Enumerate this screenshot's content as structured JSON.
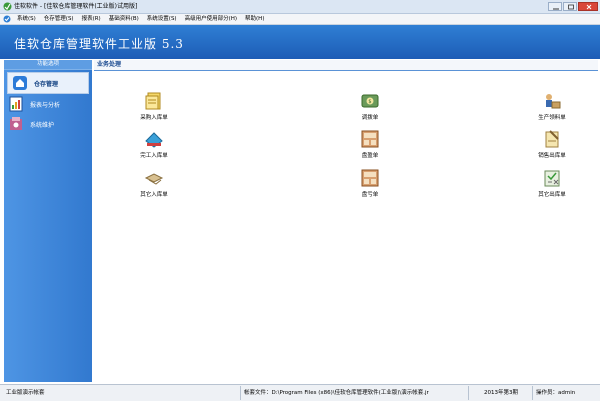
{
  "window": {
    "title": "佳软软件 - [佳软仓库管理软件(工业版)试用版]"
  },
  "menu": [
    "系统(S)",
    "仓存管理(S)",
    "报表(R)",
    "基础资料(B)",
    "系统设置(S)",
    "高级用户使用部分(H)",
    "帮助(H)"
  ],
  "banner": {
    "title": "佳软仓库管理软件工业版 5.3"
  },
  "sidebar": {
    "header": "功能选项",
    "items": [
      {
        "label": "仓存管理",
        "icon": "warehouse-icon"
      },
      {
        "label": "报表与分析",
        "icon": "report-icon"
      },
      {
        "label": "系统维护",
        "icon": "maintenance-icon"
      }
    ]
  },
  "main": {
    "header": "业务处理",
    "items": [
      {
        "label": "采购入库单",
        "icon": "purchase-receipt-icon"
      },
      {
        "label": "调拨单",
        "icon": "transfer-icon"
      },
      {
        "label": "生产领料单",
        "icon": "material-requisition-icon"
      },
      {
        "label": "完工入库单",
        "icon": "completion-receipt-icon"
      },
      {
        "label": "盘盈单",
        "icon": "inventory-gain-icon"
      },
      {
        "label": "销售出库单",
        "icon": "sales-delivery-icon"
      },
      {
        "label": "其它入库单",
        "icon": "other-receipt-icon"
      },
      {
        "label": "盘亏单",
        "icon": "inventory-loss-icon"
      },
      {
        "label": "其它出库单",
        "icon": "other-delivery-icon"
      }
    ]
  },
  "status": {
    "company": "工业版演示帐套",
    "account_file": "帐套文件：D:\\Program Files (x86)\\佳软仓库管理软件(工业版)\\演示帐套.jr",
    "period": "2013年第3期",
    "operator": "操作员：admin"
  },
  "colors": {
    "banner": "#2a72cc",
    "sidebar": "#3f86db",
    "accent": "#1a4a90"
  }
}
